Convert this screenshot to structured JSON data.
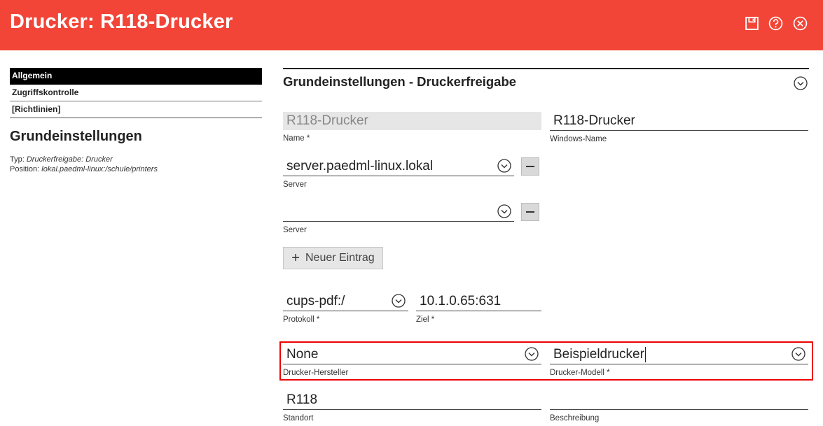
{
  "header": {
    "title": "Drucker: R118-Drucker",
    "icons": [
      "save-icon",
      "help-icon",
      "close-icon"
    ],
    "color": "#f24537"
  },
  "sidebar": {
    "items": [
      {
        "label": "Allgemein",
        "active": true
      },
      {
        "label": "Zugriffskontrolle",
        "active": false
      },
      {
        "label": "[Richtlinien]",
        "active": false
      }
    ],
    "title": "Grundeinstellungen",
    "type_label": "Typ:",
    "type_value": "Druckerfreigabe: Drucker",
    "position_label": "Position:",
    "position_value": "lokal.paedml-linux:/schule/printers"
  },
  "main": {
    "section_title": "Grundeinstellungen - Druckerfreigabe",
    "name": {
      "value": "R118-Drucker",
      "label": "Name *"
    },
    "windows_name": {
      "value": "R118-Drucker",
      "label": "Windows-Name"
    },
    "server1": {
      "value": "server.paedml-linux.lokal",
      "label": "Server"
    },
    "server2": {
      "value": "",
      "label": "Server"
    },
    "add_entry": "Neuer Eintrag",
    "protokoll": {
      "value": "cups-pdf:/",
      "label": "Protokoll *"
    },
    "ziel": {
      "value": "10.1.0.65:631",
      "label": "Ziel *"
    },
    "hersteller": {
      "value": "None",
      "label": "Drucker-Hersteller"
    },
    "modell": {
      "value": "Beispieldrucker",
      "label": "Drucker-Modell *"
    },
    "standort": {
      "value": "R118",
      "label": "Standort"
    },
    "beschreibung": {
      "value": "",
      "label": "Beschreibung"
    }
  }
}
